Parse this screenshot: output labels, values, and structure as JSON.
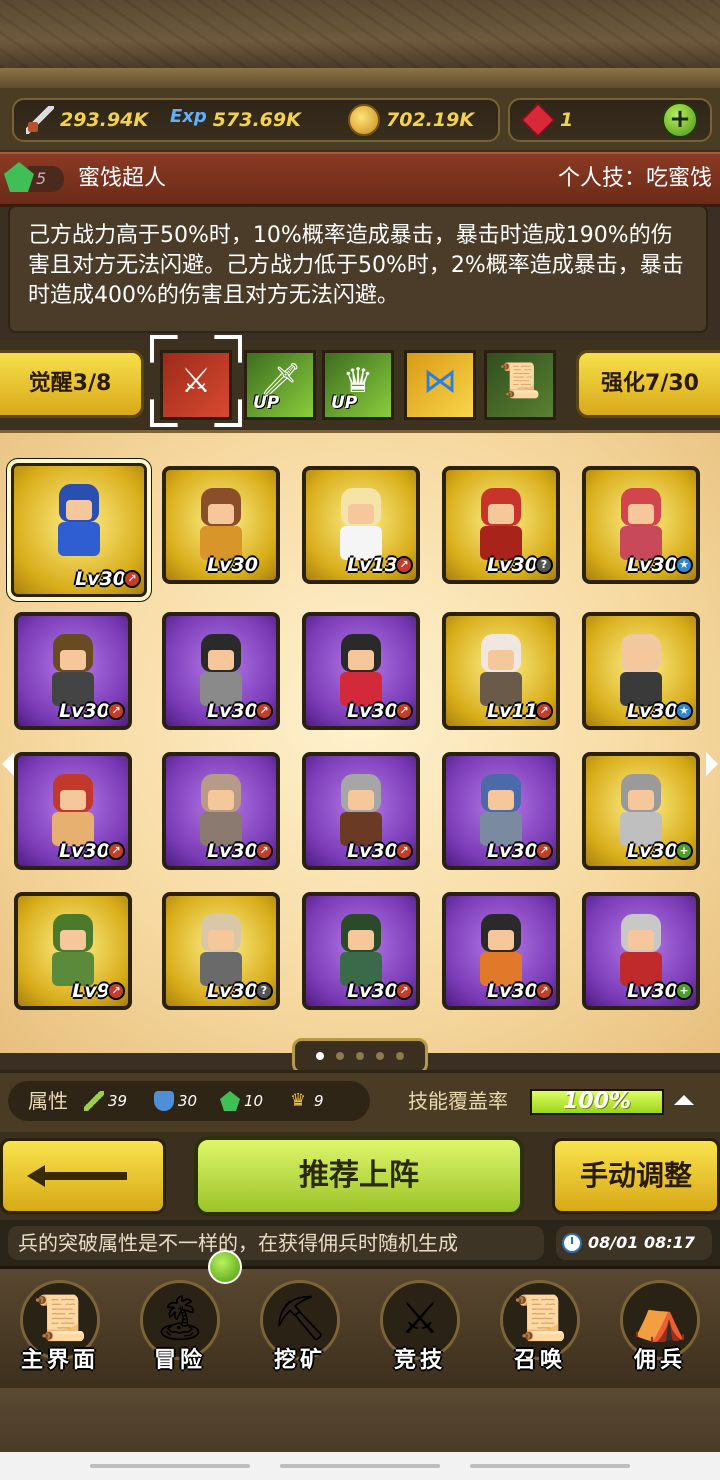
{
  "currencies": {
    "attack": "293.94K",
    "exp_label": "Exp",
    "exp": "573.69K",
    "gold": "702.19K",
    "gems": "1",
    "add_label": "+"
  },
  "skill": {
    "level": "5",
    "name": "蜜饯超人",
    "personal": "个人技：吃蜜饯",
    "description": "己方战力高于50%时，10%概率造成暴击，暴击时造成190%的伤害且对方无法闪避。己方战力低于50%时，2%概率造成暴击，暴击时造成400%的伤害且对方无法闪避。"
  },
  "tabs": {
    "awaken": "觉醒3/8",
    "enhance": "强化7/30",
    "up_label": "UP"
  },
  "grid": [
    {
      "level": "Lv30",
      "rarity": "gold",
      "badge": "red",
      "hair": "#2a4fb0",
      "cloth": "#2f5ed2",
      "selected": true
    },
    {
      "level": "Lv30",
      "rarity": "gold",
      "badge": "none",
      "hair": "#8a4f2a",
      "cloth": "#d8952a"
    },
    {
      "level": "Lv13",
      "rarity": "gold",
      "badge": "red",
      "hair": "#f4e4a8",
      "cloth": "#f5f5f5"
    },
    {
      "level": "Lv30",
      "rarity": "gold",
      "badge": "gray",
      "hair": "#c8342a",
      "cloth": "#a8231a"
    },
    {
      "level": "Lv30",
      "rarity": "gold",
      "badge": "blue",
      "hair": "#d2454a",
      "cloth": "#c84a5a"
    },
    {
      "level": "Lv30",
      "rarity": "purple",
      "badge": "red",
      "hair": "#6a4a22",
      "cloth": "#444"
    },
    {
      "level": "Lv30",
      "rarity": "purple",
      "badge": "red",
      "hair": "#2a2a2a",
      "cloth": "#8a8a8a"
    },
    {
      "level": "Lv30",
      "rarity": "purple",
      "badge": "red",
      "hair": "#2a2a2a",
      "cloth": "#d22a3a"
    },
    {
      "level": "Lv11",
      "rarity": "gold",
      "badge": "red",
      "hair": "#f0e8e0",
      "cloth": "#6a5a4a"
    },
    {
      "level": "Lv30",
      "rarity": "gold",
      "badge": "blue",
      "hair": "#f2c8a0",
      "cloth": "#3a3a3a"
    },
    {
      "level": "Lv30",
      "rarity": "purple",
      "badge": "red",
      "hair": "#c2382a",
      "cloth": "#e8b070"
    },
    {
      "level": "Lv30",
      "rarity": "purple",
      "badge": "red",
      "hair": "#b89a88",
      "cloth": "#8a7a70"
    },
    {
      "level": "Lv30",
      "rarity": "purple",
      "badge": "red",
      "hair": "#a6a6a6",
      "cloth": "#6a3a24"
    },
    {
      "level": "Lv30",
      "rarity": "purple",
      "badge": "red",
      "hair": "#4a6aaa",
      "cloth": "#7a8aa0"
    },
    {
      "level": "Lv30",
      "rarity": "gold",
      "badge": "green",
      "hair": "#9a9a9a",
      "cloth": "#bfbfbf"
    },
    {
      "level": "Lv9",
      "rarity": "gold",
      "badge": "red",
      "hair": "#4a7a2a",
      "cloth": "#5a8a3a"
    },
    {
      "level": "Lv30",
      "rarity": "gold",
      "badge": "gray",
      "hair": "#d8c8a8",
      "cloth": "#6a6a6a"
    },
    {
      "level": "Lv30",
      "rarity": "purple",
      "badge": "red",
      "hair": "#2a4a2a",
      "cloth": "#3a6a4a"
    },
    {
      "level": "Lv30",
      "rarity": "purple",
      "badge": "red",
      "hair": "#2a2a2a",
      "cloth": "#e07a2a"
    },
    {
      "level": "Lv30",
      "rarity": "purple",
      "badge": "green",
      "hair": "#c8c8c8",
      "cloth": "#c02a2a"
    }
  ],
  "attributes": {
    "label": "属性",
    "strength": "39",
    "defense": "30",
    "agility": "10",
    "crown": "9",
    "skill_coverage_label": "技能覆盖率",
    "skill_coverage": "100%",
    "skill_coverage_fraction": 1.0
  },
  "actions": {
    "recommend": "推荐上阵",
    "manual": "手动调整"
  },
  "tip": {
    "text": "兵的突破属性是不一样的，在获得佣兵时随机生成",
    "time": "08/01 08:17"
  },
  "nav": [
    {
      "label": "主界面",
      "icon": "map-scroll-icon",
      "glyph": "📜"
    },
    {
      "label": "冒险",
      "icon": "island-icon",
      "glyph": "🏝"
    },
    {
      "label": "挖矿",
      "icon": "pickaxe-icon",
      "glyph": "⛏"
    },
    {
      "label": "竞技",
      "icon": "crossed-swords-icon",
      "glyph": "⚔"
    },
    {
      "label": "召唤",
      "icon": "summon-scroll-icon",
      "glyph": "📜"
    },
    {
      "label": "佣兵",
      "icon": "tent-icon",
      "glyph": "⛺"
    }
  ],
  "colors": {
    "accent_gold": "#f2d34a",
    "accent_green": "#9dd41a",
    "skill_header": "#8a3a24"
  }
}
